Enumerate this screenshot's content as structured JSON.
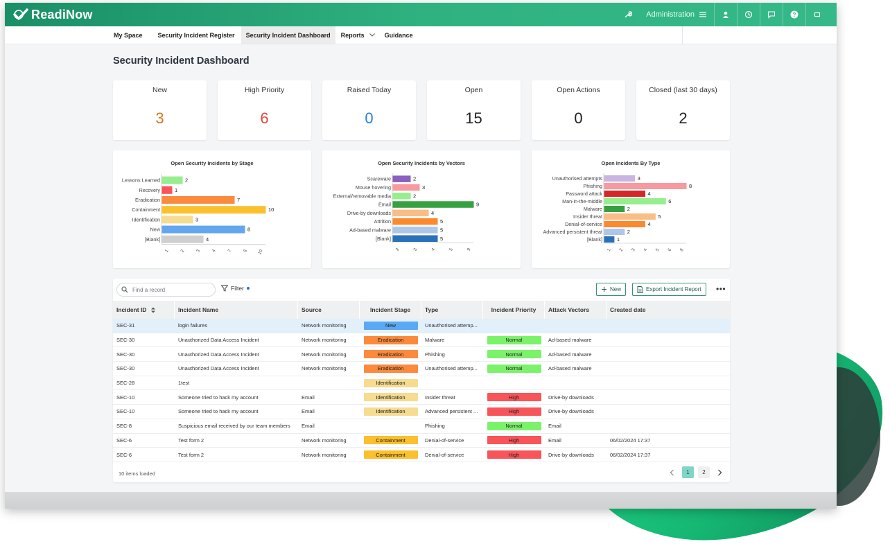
{
  "app": {
    "logo_text": "ReadiNow",
    "admin_label": "Administration",
    "brand_color": "#2fb180"
  },
  "nav": {
    "items": [
      {
        "label": "My Space"
      },
      {
        "label": "Security Incident Register"
      },
      {
        "label": "Security Incident Dashboard"
      },
      {
        "label": "Reports"
      },
      {
        "label": "Guidance"
      }
    ],
    "active_index": 2
  },
  "page": {
    "title": "Security Incident Dashboard"
  },
  "summary_cards": [
    {
      "label": "New",
      "value": "3",
      "color": "#d4761a"
    },
    {
      "label": "High Priority",
      "value": "6",
      "color": "#e0463f"
    },
    {
      "label": "Raised Today",
      "value": "0",
      "color": "#2a7fd4"
    },
    {
      "label": "Open",
      "value": "15",
      "color": "#222222"
    },
    {
      "label": "Open Actions",
      "value": "0",
      "color": "#222222"
    },
    {
      "label": "Closed (last 30 days)",
      "value": "2",
      "color": "#222222"
    }
  ],
  "chart_data": [
    {
      "type": "bar",
      "orientation": "horizontal",
      "title": "Open Security Incidents by Stage",
      "categories": [
        "Lessons Learned",
        "Recovery",
        "Eradication",
        "Containment",
        "Identification",
        "New",
        "[Blank]"
      ],
      "values": [
        2,
        1,
        7,
        10,
        3,
        8,
        4
      ],
      "colors": [
        "#96ee8e",
        "#f9545c",
        "#fb8a3c",
        "#fbc02d",
        "#f6dc90",
        "#63a6f0",
        "#cfcfcf"
      ],
      "ticks": [
        "1",
        "2",
        "3",
        "4",
        "7",
        "8",
        "10"
      ],
      "xlim": [
        0,
        10
      ]
    },
    {
      "type": "bar",
      "orientation": "horizontal",
      "title": "Open Security Incidents by Vectors",
      "categories": [
        "Scareware",
        "Mouse hovering",
        "External/removable media",
        "Email",
        "Drive-by downloads",
        "Attrition",
        "Ad-based malware",
        "[Blank]"
      ],
      "values": [
        2,
        3,
        2,
        9,
        4,
        5,
        5,
        5
      ],
      "colors": [
        "#8b5fbf",
        "#f7999f",
        "#96ee8e",
        "#36a141",
        "#f9bd85",
        "#fb8a2e",
        "#aec6e8",
        "#2a70b8"
      ],
      "ticks": [
        "2",
        "3",
        "4",
        "5",
        "9"
      ],
      "xlim": [
        0,
        9
      ]
    },
    {
      "type": "bar",
      "orientation": "horizontal",
      "title": "Open Incidents By Type",
      "categories": [
        "Unauthorised attempts",
        "Phishing",
        "Password attack",
        "Man-in-the-middle",
        "Malware",
        "Insider threat",
        "Denial-of-service",
        "Advanced persistent threat",
        "[Blank]"
      ],
      "values": [
        3,
        8,
        4,
        6,
        2,
        5,
        4,
        2,
        1
      ],
      "colors": [
        "#c8b5e0",
        "#f7999f",
        "#d62728",
        "#96ee8e",
        "#36a141",
        "#f9bd85",
        "#fb8a2e",
        "#aec6e8",
        "#2a70b8"
      ],
      "ticks": [
        "1",
        "2",
        "3",
        "4",
        "5",
        "6",
        "8"
      ],
      "xlim": [
        0,
        8
      ]
    }
  ],
  "grid": {
    "search_placeholder": "Find a record",
    "filter_label": "Filter",
    "new_label": "New",
    "export_label": "Export Incident Report",
    "more_label": "•••",
    "columns": [
      "Incident ID",
      "Incident Name",
      "Source",
      "Incident Stage",
      "Type",
      "Incident Priority",
      "Attack Vectors",
      "Created date"
    ],
    "rows": [
      {
        "id": "SEC-31",
        "name": "login failures",
        "source": "Network monitoring",
        "stage": "New",
        "type": "Unauthorised attemp...",
        "priority": "",
        "vectors": "",
        "created": ""
      },
      {
        "id": "SEC-30",
        "name": "Unauthorized Data Access Incident",
        "source": "Network monitoring",
        "stage": "Eradication",
        "type": "Malware",
        "priority": "Normal",
        "vectors": "Ad-based malware",
        "created": ""
      },
      {
        "id": "SEC-30",
        "name": "Unauthorized Data Access Incident",
        "source": "Network monitoring",
        "stage": "Eradication",
        "type": "Phishing",
        "priority": "Normal",
        "vectors": "Ad-based malware",
        "created": ""
      },
      {
        "id": "SEC-30",
        "name": "Unauthorized Data Access Incident",
        "source": "Network monitoring",
        "stage": "Eradication",
        "type": "Unauthorised attemp...",
        "priority": "Normal",
        "vectors": "Ad-based malware",
        "created": ""
      },
      {
        "id": "SEC-28",
        "name": "1test",
        "source": "",
        "stage": "Identification",
        "type": "",
        "priority": "",
        "vectors": "",
        "created": ""
      },
      {
        "id": "SEC-10",
        "name": "Someone tried to hack my account",
        "source": "Email",
        "stage": "Identification",
        "type": "Insider threat",
        "priority": "High",
        "vectors": "Drive-by downloads",
        "created": ""
      },
      {
        "id": "SEC-10",
        "name": "Someone tried to hack my account",
        "source": "Email",
        "stage": "Identification",
        "type": "Advanced persistent ...",
        "priority": "High",
        "vectors": "Drive-by downloads",
        "created": ""
      },
      {
        "id": "SEC-8",
        "name": "Suspicious email received by our team members",
        "source": "Email",
        "stage": "",
        "type": "Phishing",
        "priority": "Normal",
        "vectors": "Email",
        "created": ""
      },
      {
        "id": "SEC-6",
        "name": "Test form 2",
        "source": "Network monitoring",
        "stage": "Containment",
        "type": "Denial-of-service",
        "priority": "High",
        "vectors": "Email",
        "created": "06/02/2024 17:37"
      },
      {
        "id": "SEC-6",
        "name": "Test form 2",
        "source": "Network monitoring",
        "stage": "Containment",
        "type": "Denial-of-service",
        "priority": "High",
        "vectors": "Drive-by downloads",
        "created": "06/02/2024 17:37"
      }
    ],
    "selected_row": 0,
    "stage_colors": {
      "New": "#5aa9f5",
      "Eradication": "#fb8a3c",
      "Identification": "#f6dc90",
      "Containment": "#fbc02d"
    },
    "priority_colors": {
      "Normal": "#7cf26a",
      "High": "#f7555a"
    },
    "items_loaded": "10 items loaded",
    "pages": [
      "1",
      "2"
    ],
    "current_page": "1"
  }
}
